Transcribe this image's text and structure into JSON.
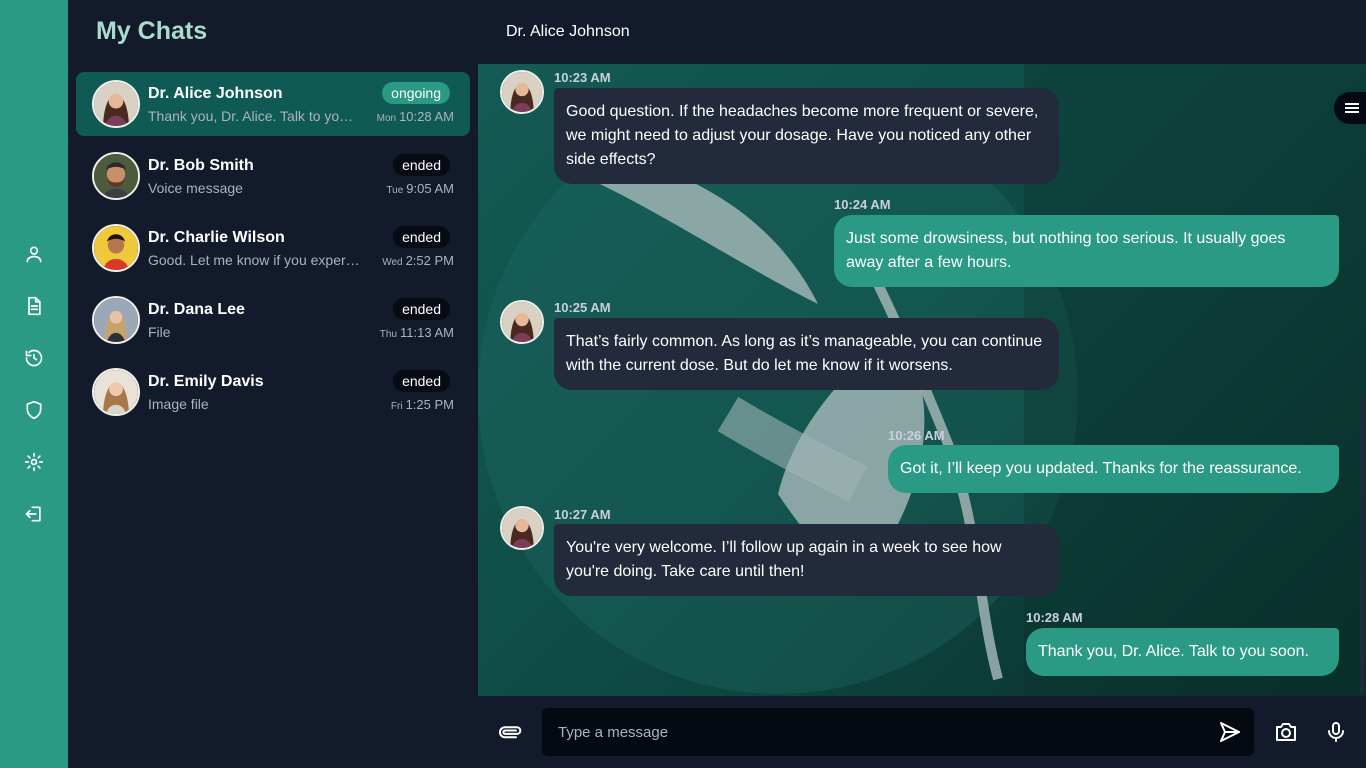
{
  "sidebar": {
    "icons": [
      "user-icon",
      "document-icon",
      "history-icon",
      "shield-icon",
      "gear-icon",
      "logout-icon"
    ]
  },
  "chat_list": {
    "title": "My Chats",
    "items": [
      {
        "name": "Dr. Alice Johnson",
        "preview": "Thank you, Dr. Alice. Talk to you soon.",
        "status": "ongoing",
        "day": "Mon",
        "time": "10:28 AM",
        "active": true
      },
      {
        "name": "Dr. Bob Smith",
        "preview": "Voice message",
        "status": "ended",
        "day": "Tue",
        "time": "9:05 AM"
      },
      {
        "name": "Dr. Charlie Wilson",
        "preview": "Good. Let me know if you experience any changes.",
        "status": "ended",
        "day": "Wed",
        "time": "2:52 PM"
      },
      {
        "name": "Dr. Dana Lee",
        "preview": "File",
        "status": "ended",
        "day": "Thu",
        "time": "11:13 AM"
      },
      {
        "name": "Dr. Emily Davis",
        "preview": "Image file",
        "status": "ended",
        "day": "Fri",
        "time": "1:25 PM"
      }
    ]
  },
  "conversation": {
    "title": "Dr. Alice Johnson",
    "messages": [
      {
        "direction": "in",
        "time": "10:23 AM",
        "text": "Good question. If the headaches become more frequent or severe, we might need to adjust your dosage. Have you noticed any other side effects?"
      },
      {
        "direction": "out",
        "time": "10:24 AM",
        "text": "Just some drowsiness, but nothing too serious. It usually goes away after a few hours."
      },
      {
        "direction": "in",
        "time": "10:25 AM",
        "text": "That’s fairly common. As long as it’s manageable, you can continue with the current dose. But do let me know if it worsens."
      },
      {
        "direction": "out",
        "time": "10:26 AM",
        "text": "Got it, I’ll keep you updated. Thanks for the reassurance."
      },
      {
        "direction": "in",
        "time": "10:27 AM",
        "text": "You're very welcome. I’ll follow up again in a week to see how you're doing. Take care until then!"
      },
      {
        "direction": "out",
        "time": "10:28 AM",
        "text": "Thank you, Dr. Alice. Talk to you soon."
      }
    ]
  },
  "composer": {
    "placeholder": "Type a message",
    "value": ""
  },
  "colors": {
    "accent": "#2a9a84",
    "panel": "#131a2b",
    "incoming_bubble": "#222a3b",
    "outgoing_bubble": "#2a9a84",
    "active_item": "#0f5a55"
  }
}
